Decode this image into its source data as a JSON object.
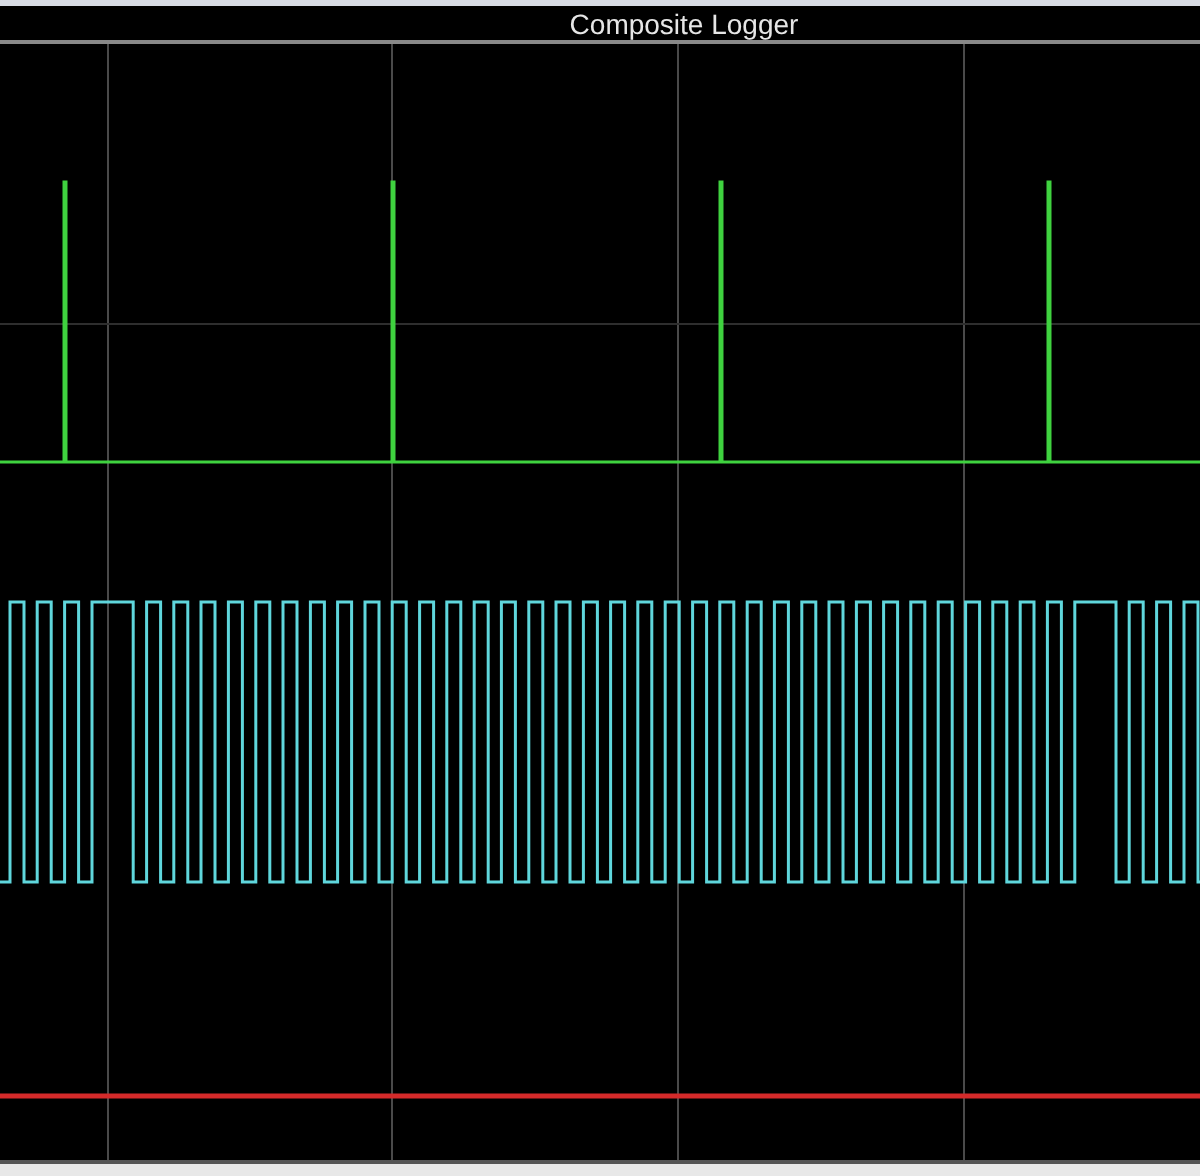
{
  "window": {
    "title": "Composite Logger"
  }
}
